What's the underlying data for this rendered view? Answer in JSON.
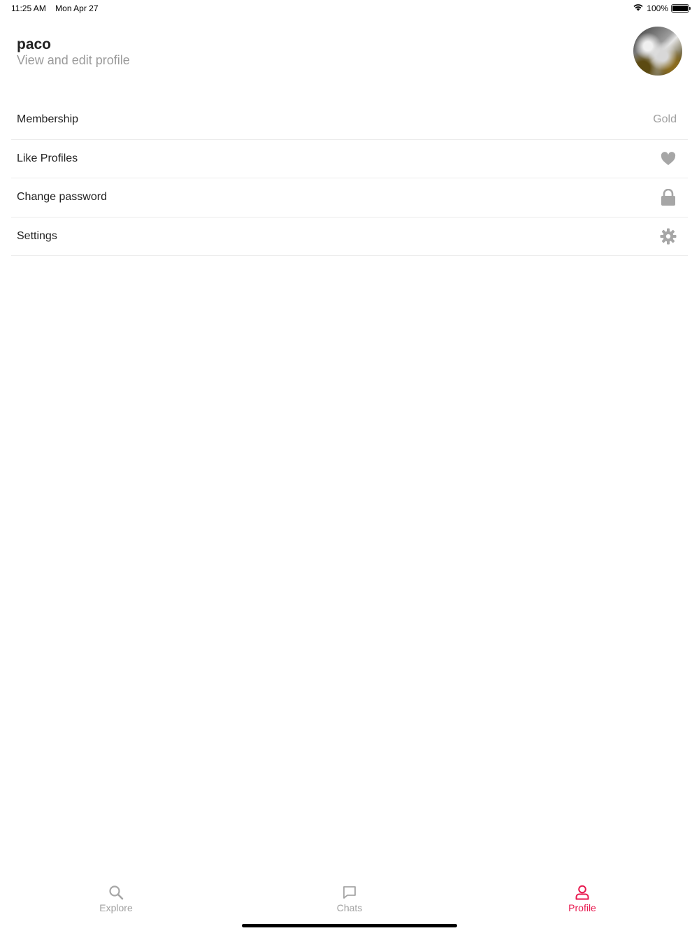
{
  "status_bar": {
    "time": "11:25 AM",
    "date": "Mon Apr 27",
    "battery": "100%"
  },
  "profile": {
    "name": "paco",
    "subtitle": "View and edit profile"
  },
  "menu": [
    {
      "label": "Membership",
      "value": "Gold"
    },
    {
      "label": "Like Profiles",
      "icon": "heart-icon"
    },
    {
      "label": "Change password",
      "icon": "lock-icon"
    },
    {
      "label": "Settings",
      "icon": "gear-icon"
    }
  ],
  "tabs": [
    {
      "label": "Explore",
      "icon": "search-icon",
      "active": false
    },
    {
      "label": "Chats",
      "icon": "chat-bubble-icon",
      "active": false
    },
    {
      "label": "Profile",
      "icon": "user-icon",
      "active": true
    }
  ],
  "colors": {
    "accent": "#e8194f",
    "muted": "#a0a0a0",
    "icon": "#a6a6a6"
  }
}
